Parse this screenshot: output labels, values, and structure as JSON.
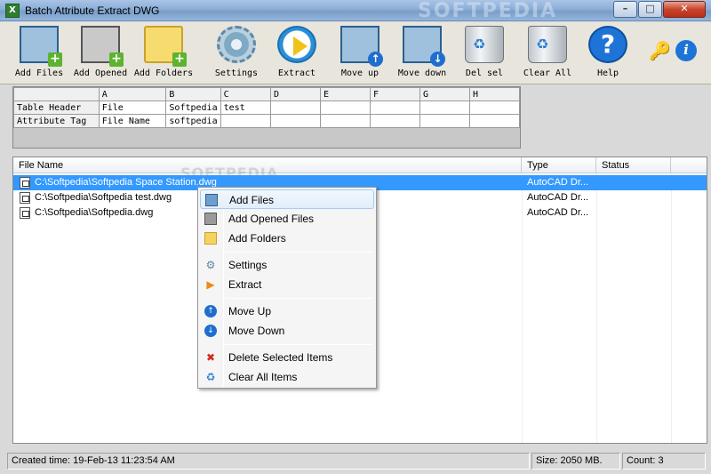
{
  "window": {
    "title": "Batch Attribute Extract DWG",
    "watermark": "SOFTPEDIA",
    "controls": {
      "minimize": "–",
      "maximize": "□",
      "close": "✕"
    }
  },
  "toolbar": {
    "buttons": [
      {
        "id": "add-files",
        "label": "Add Files",
        "icon": "add-files-icon"
      },
      {
        "id": "add-opened-files",
        "label": "Add Opened",
        "icon": "add-opened-files-icon"
      },
      {
        "id": "add-folders",
        "label": "Add Folders",
        "icon": "add-folders-icon"
      },
      {
        "id": "settings",
        "label": "Settings",
        "icon": "gears-icon"
      },
      {
        "id": "extract",
        "label": "Extract",
        "icon": "play-icon"
      },
      {
        "id": "move-up",
        "label": "Move up",
        "icon": "move-up-icon"
      },
      {
        "id": "move-down",
        "label": "Move down",
        "icon": "move-down-icon"
      },
      {
        "id": "del-sel",
        "label": "Del sel",
        "icon": "recycle-bin-icon"
      },
      {
        "id": "clear-all",
        "label": "Clear All",
        "icon": "recycle-bin-clean-icon"
      },
      {
        "id": "help",
        "label": "Help",
        "icon": "help-icon"
      }
    ],
    "extras": {
      "key_icon": "🔑",
      "info_icon": "i"
    }
  },
  "attribute_grid": {
    "columns": [
      "A",
      "B",
      "C",
      "D",
      "E",
      "F",
      "G",
      "H"
    ],
    "rows": [
      {
        "label": "Table Header",
        "cells": [
          "File",
          "Softpedia",
          "test",
          "",
          "",
          "",
          "",
          ""
        ]
      },
      {
        "label": "Attribute Tag",
        "cells": [
          "File Name",
          "softpedia",
          "",
          "",
          "",
          "",
          "",
          ""
        ]
      }
    ]
  },
  "file_list": {
    "watermark": "SOFTPEDIA",
    "headers": {
      "name": "File Name",
      "type": "Type",
      "status": "Status"
    },
    "rows": [
      {
        "name": "C:\\Softpedia\\Softpedia Space Station.dwg",
        "type": "AutoCAD Dr...",
        "status": "",
        "selected": true
      },
      {
        "name": "C:\\Softpedia\\Softpedia test.dwg",
        "type": "AutoCAD Dr...",
        "status": "",
        "selected": false
      },
      {
        "name": "C:\\Softpedia\\Softpedia.dwg",
        "type": "AutoCAD Dr...",
        "status": "",
        "selected": false
      }
    ]
  },
  "context_menu": {
    "items": [
      {
        "label": "Add Files",
        "icon": "add-files-icon",
        "hover": true
      },
      {
        "label": "Add Opened Files",
        "icon": "add-opened-files-icon"
      },
      {
        "label": "Add Folders",
        "icon": "add-folders-icon"
      },
      {
        "label": "Settings",
        "icon": "gear-icon"
      },
      {
        "label": "Extract",
        "icon": "play-icon"
      },
      {
        "label": "Move Up",
        "icon": "move-up-icon"
      },
      {
        "label": "Move Down",
        "icon": "move-down-icon"
      },
      {
        "label": "Delete Selected Items",
        "icon": "delete-icon"
      },
      {
        "label": "Clear All Items",
        "icon": "clear-all-icon"
      }
    ]
  },
  "status_bar": {
    "created": "Created time: 19-Feb-13 11:23:54 AM",
    "size": "Size: 2050 MB.",
    "count": "Count:  3"
  },
  "colors": {
    "selection": "#3399ff",
    "toolbar_bg": "#e8e6dc",
    "close_button": "#c7442b"
  }
}
